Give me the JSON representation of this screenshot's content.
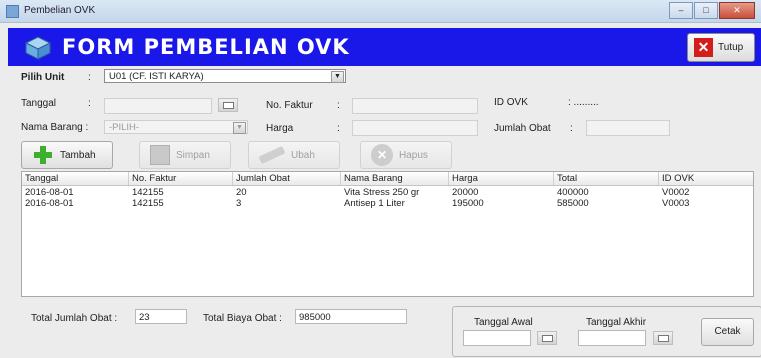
{
  "window": {
    "title": "Pembelian OVK",
    "min_glyph": "–",
    "max_glyph": "□",
    "close_glyph": "✕"
  },
  "header": {
    "title": "FORM PEMBELIAN OVK",
    "close_label": "Tutup",
    "close_glyph": "✕",
    "color": "#1a18e8"
  },
  "form": {
    "unit_label": "Pilih Unit",
    "colon": ":",
    "unit_value": "U01 (CF. ISTI KARYA)",
    "tanggal_label": "Tanggal",
    "faktur_label": "No. Faktur",
    "id_ovk_label": "ID OVK",
    "id_ovk_value": ": .........",
    "nama_barang_label": "Nama Barang :",
    "nama_barang_value": "-PILIH-",
    "harga_label": "Harga",
    "jumlah_obat_label": "Jumlah Obat",
    "dropdown_arrow": "▼"
  },
  "buttons": {
    "tambah": "Tambah",
    "simpan": "Simpan",
    "ubah": "Ubah",
    "hapus": "Hapus",
    "hapus_glyph": "✕"
  },
  "table": {
    "columns": [
      "Tanggal",
      "No. Faktur",
      "Jumlah Obat",
      "Nama Barang",
      "Harga",
      "Total",
      "ID OVK"
    ],
    "rows": [
      [
        "2016-08-01",
        "142155",
        "20",
        "Vita Stress 250 gr",
        "20000",
        "400000",
        "V0002"
      ],
      [
        "2016-08-01",
        "142155",
        "3",
        "Antisep 1 Liter",
        "195000",
        "585000",
        "V0003"
      ]
    ]
  },
  "totals": {
    "jumlah_label": "Total Jumlah Obat :",
    "jumlah_value": "23",
    "biaya_label": "Total Biaya Obat :",
    "biaya_value": "985000"
  },
  "report": {
    "awal_label": "Tanggal Awal",
    "akhir_label": "Tanggal Akhir",
    "cetak_label": "Cetak"
  }
}
